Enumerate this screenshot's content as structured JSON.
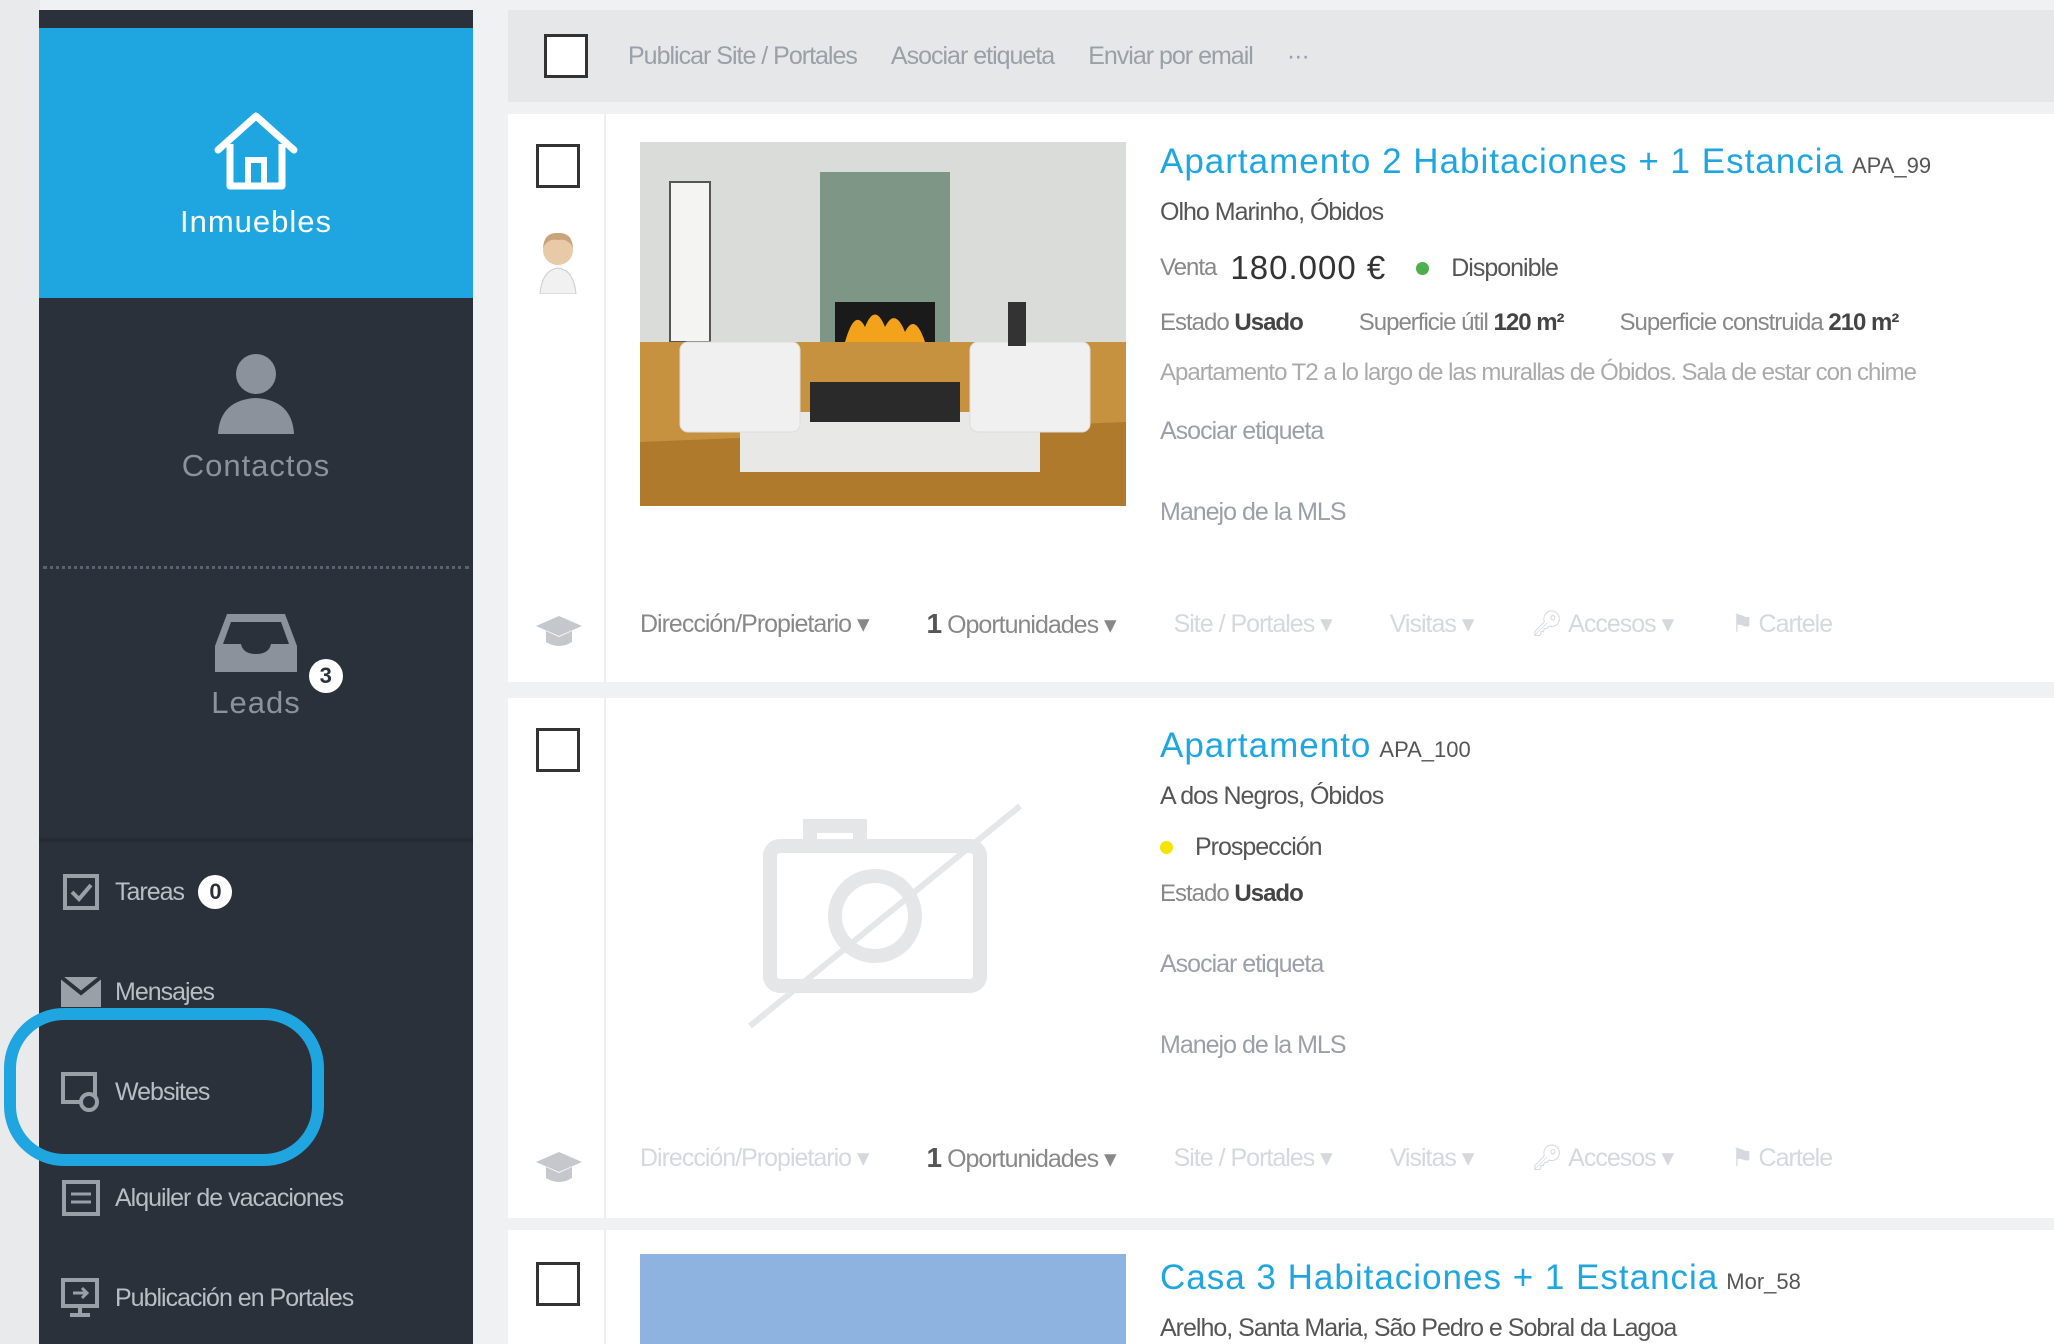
{
  "sidebar": {
    "main_items": [
      {
        "label": "Inmuebles",
        "icon": "home-icon",
        "active": true
      },
      {
        "label": "Contactos",
        "icon": "user-icon"
      },
      {
        "label": "Leads",
        "icon": "inbox-icon",
        "badge": "3"
      }
    ],
    "small_items": [
      {
        "label": "Tareas",
        "icon": "checkbox-icon",
        "badge": "0"
      },
      {
        "label": "Mensajes",
        "icon": "envelope-icon"
      },
      {
        "label": "Websites",
        "icon": "website-gear-icon"
      },
      {
        "label": "Alquiler de vacaciones",
        "icon": "calendar-icon"
      },
      {
        "label": "Publicación en Portales",
        "icon": "monitor-export-icon"
      }
    ],
    "colors": {
      "active_bg": "#1fa6e0",
      "bg": "#2b313a",
      "highlight_ring": "#1fa6e0"
    }
  },
  "toolbar": {
    "actions": [
      "Publicar Site / Portales",
      "Asociar etiqueta",
      "Enviar por email",
      "···"
    ]
  },
  "listings": [
    {
      "title": "Apartamento 2 Habitaciones + 1 Estancia",
      "ref": "APA_99",
      "location": "Olho Marinho, Óbidos",
      "deal": "Venta",
      "price": "180.000 €",
      "status": "Disponible",
      "status_color": "#4caf50",
      "estado_label": "Estado",
      "estado_value": "Usado",
      "sup_util_label": "Superficie útil",
      "sup_util_value": "120 m²",
      "sup_const_label": "Superficie construida",
      "sup_const_value": "210 m²",
      "description": "Apartamento T2 a lo largo de las murallas de Óbidos. Sala de estar con chime",
      "tag_link": "Asociar etiqueta",
      "mls_link": "Manejo de la MLS",
      "actions": [
        "Dirección/Propietario ▾",
        "1",
        "Oportunidades ▾",
        "Site / Portales ▾",
        "Visitas ▾",
        "Accesos ▾",
        "Cartele"
      ]
    },
    {
      "title": "Apartamento",
      "ref": "APA_100",
      "location": "A dos Negros, Óbidos",
      "status": "Prospección",
      "status_color": "#f5e400",
      "estado_label": "Estado",
      "estado_value": "Usado",
      "tag_link": "Asociar etiqueta",
      "mls_link": "Manejo de la MLS",
      "actions": [
        "Dirección/Propietario ▾",
        "1",
        "Oportunidades ▾",
        "Site / Portales ▾",
        "Visitas ▾",
        "Accesos ▾",
        "Cartele"
      ]
    },
    {
      "title": "Casa 3 Habitaciones + 1 Estancia",
      "ref": "Mor_58",
      "location": "Arelho, Santa Maria, São Pedro e Sobral da Lagoa"
    }
  ]
}
